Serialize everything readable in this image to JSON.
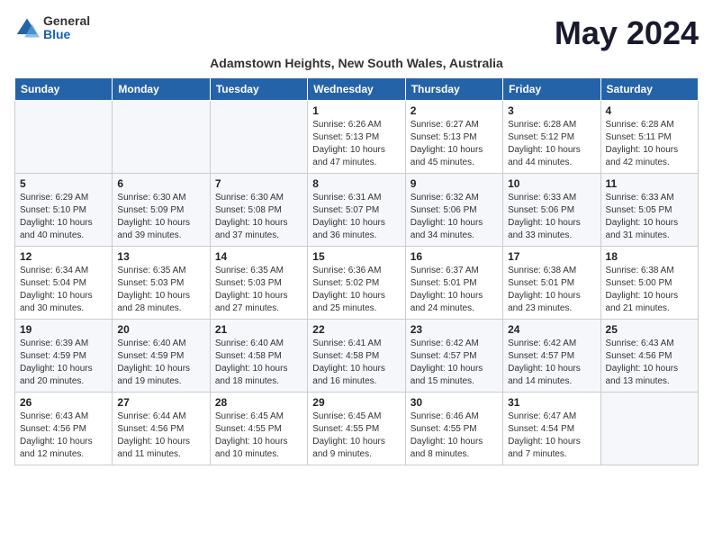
{
  "header": {
    "logo": {
      "general": "General",
      "blue": "Blue"
    },
    "title": "May 2024",
    "subtitle": "Adamstown Heights, New South Wales, Australia"
  },
  "days_of_week": [
    "Sunday",
    "Monday",
    "Tuesday",
    "Wednesday",
    "Thursday",
    "Friday",
    "Saturday"
  ],
  "weeks": [
    [
      {
        "day": "",
        "info": ""
      },
      {
        "day": "",
        "info": ""
      },
      {
        "day": "",
        "info": ""
      },
      {
        "day": "1",
        "info": "Sunrise: 6:26 AM\nSunset: 5:13 PM\nDaylight: 10 hours and 47 minutes."
      },
      {
        "day": "2",
        "info": "Sunrise: 6:27 AM\nSunset: 5:13 PM\nDaylight: 10 hours and 45 minutes."
      },
      {
        "day": "3",
        "info": "Sunrise: 6:28 AM\nSunset: 5:12 PM\nDaylight: 10 hours and 44 minutes."
      },
      {
        "day": "4",
        "info": "Sunrise: 6:28 AM\nSunset: 5:11 PM\nDaylight: 10 hours and 42 minutes."
      }
    ],
    [
      {
        "day": "5",
        "info": "Sunrise: 6:29 AM\nSunset: 5:10 PM\nDaylight: 10 hours and 40 minutes."
      },
      {
        "day": "6",
        "info": "Sunrise: 6:30 AM\nSunset: 5:09 PM\nDaylight: 10 hours and 39 minutes."
      },
      {
        "day": "7",
        "info": "Sunrise: 6:30 AM\nSunset: 5:08 PM\nDaylight: 10 hours and 37 minutes."
      },
      {
        "day": "8",
        "info": "Sunrise: 6:31 AM\nSunset: 5:07 PM\nDaylight: 10 hours and 36 minutes."
      },
      {
        "day": "9",
        "info": "Sunrise: 6:32 AM\nSunset: 5:06 PM\nDaylight: 10 hours and 34 minutes."
      },
      {
        "day": "10",
        "info": "Sunrise: 6:33 AM\nSunset: 5:06 PM\nDaylight: 10 hours and 33 minutes."
      },
      {
        "day": "11",
        "info": "Sunrise: 6:33 AM\nSunset: 5:05 PM\nDaylight: 10 hours and 31 minutes."
      }
    ],
    [
      {
        "day": "12",
        "info": "Sunrise: 6:34 AM\nSunset: 5:04 PM\nDaylight: 10 hours and 30 minutes."
      },
      {
        "day": "13",
        "info": "Sunrise: 6:35 AM\nSunset: 5:03 PM\nDaylight: 10 hours and 28 minutes."
      },
      {
        "day": "14",
        "info": "Sunrise: 6:35 AM\nSunset: 5:03 PM\nDaylight: 10 hours and 27 minutes."
      },
      {
        "day": "15",
        "info": "Sunrise: 6:36 AM\nSunset: 5:02 PM\nDaylight: 10 hours and 25 minutes."
      },
      {
        "day": "16",
        "info": "Sunrise: 6:37 AM\nSunset: 5:01 PM\nDaylight: 10 hours and 24 minutes."
      },
      {
        "day": "17",
        "info": "Sunrise: 6:38 AM\nSunset: 5:01 PM\nDaylight: 10 hours and 23 minutes."
      },
      {
        "day": "18",
        "info": "Sunrise: 6:38 AM\nSunset: 5:00 PM\nDaylight: 10 hours and 21 minutes."
      }
    ],
    [
      {
        "day": "19",
        "info": "Sunrise: 6:39 AM\nSunset: 4:59 PM\nDaylight: 10 hours and 20 minutes."
      },
      {
        "day": "20",
        "info": "Sunrise: 6:40 AM\nSunset: 4:59 PM\nDaylight: 10 hours and 19 minutes."
      },
      {
        "day": "21",
        "info": "Sunrise: 6:40 AM\nSunset: 4:58 PM\nDaylight: 10 hours and 18 minutes."
      },
      {
        "day": "22",
        "info": "Sunrise: 6:41 AM\nSunset: 4:58 PM\nDaylight: 10 hours and 16 minutes."
      },
      {
        "day": "23",
        "info": "Sunrise: 6:42 AM\nSunset: 4:57 PM\nDaylight: 10 hours and 15 minutes."
      },
      {
        "day": "24",
        "info": "Sunrise: 6:42 AM\nSunset: 4:57 PM\nDaylight: 10 hours and 14 minutes."
      },
      {
        "day": "25",
        "info": "Sunrise: 6:43 AM\nSunset: 4:56 PM\nDaylight: 10 hours and 13 minutes."
      }
    ],
    [
      {
        "day": "26",
        "info": "Sunrise: 6:43 AM\nSunset: 4:56 PM\nDaylight: 10 hours and 12 minutes."
      },
      {
        "day": "27",
        "info": "Sunrise: 6:44 AM\nSunset: 4:56 PM\nDaylight: 10 hours and 11 minutes."
      },
      {
        "day": "28",
        "info": "Sunrise: 6:45 AM\nSunset: 4:55 PM\nDaylight: 10 hours and 10 minutes."
      },
      {
        "day": "29",
        "info": "Sunrise: 6:45 AM\nSunset: 4:55 PM\nDaylight: 10 hours and 9 minutes."
      },
      {
        "day": "30",
        "info": "Sunrise: 6:46 AM\nSunset: 4:55 PM\nDaylight: 10 hours and 8 minutes."
      },
      {
        "day": "31",
        "info": "Sunrise: 6:47 AM\nSunset: 4:54 PM\nDaylight: 10 hours and 7 minutes."
      },
      {
        "day": "",
        "info": ""
      }
    ]
  ]
}
